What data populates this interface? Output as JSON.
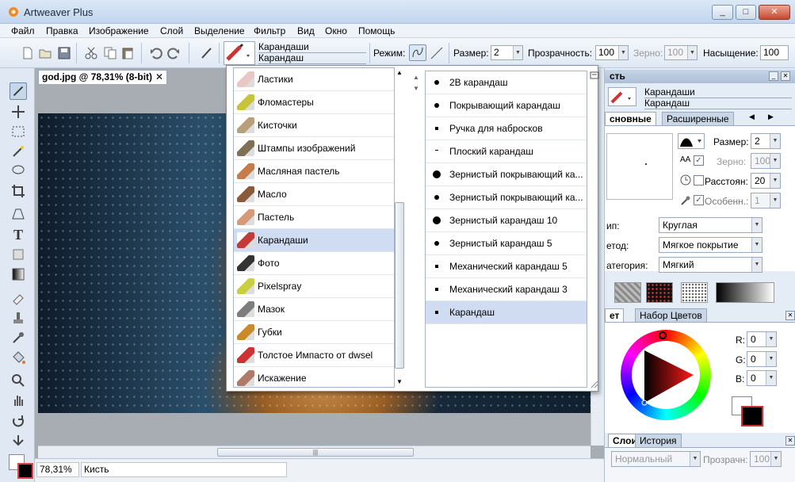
{
  "window": {
    "title": "Artweaver Plus",
    "min": "_",
    "max": "□",
    "close": "✕"
  },
  "menu": [
    "Файл",
    "Правка",
    "Изображение",
    "Слой",
    "Выделение",
    "Фильтр",
    "Вид",
    "Окно",
    "Помощь"
  ],
  "toolbar": {
    "brush_category": "Карандаши",
    "brush_variant": "Карандаш",
    "mode_label": "Режим:",
    "size_label": "Размер:",
    "size_value": "2",
    "opacity_label": "Прозрачность:",
    "opacity_value": "100",
    "grain_label": "Зерно:",
    "grain_value": "100",
    "saturation_label": "Насыщение:",
    "saturation_value": "100"
  },
  "document": {
    "tab_title": "god.jpg @ 78,31% (8-bit)",
    "close": "✕"
  },
  "status": {
    "zoom": "78,31%",
    "tool": "Кисть"
  },
  "popup": {
    "categories": [
      "Ластики",
      "Фломастеры",
      "Кисточки",
      "Штампы изображений",
      "Масляная пастель",
      "Масло",
      "Пастель",
      "Карандаши",
      "Фото",
      "Pixelspray",
      "Мазок",
      "Губки",
      "Толстое Импасто от dwsel",
      "Искажение"
    ],
    "selected_category": "Карандаши",
    "brushes": [
      "2B карандаш",
      "Покрывающий карандаш",
      "Ручка для набросков",
      "Плоский карандаш",
      "Зернистый покрывающий ка...",
      "Зернистый покрывающий ка...",
      "Зернистый карандаш 10",
      "Зернистый карандаш 5",
      "Механический карандаш 5",
      "Механический карандаш 3",
      "Карандаш"
    ],
    "selected_brush": "Карандаш"
  },
  "brush_panel": {
    "header": "сть",
    "category": "Карандаши",
    "variant": "Карандаш",
    "tab_basic": "сновные",
    "tab_advanced": "Расширенные",
    "size_label": "Размер:",
    "size_value": "2",
    "grain_label": "Зерно:",
    "grain_value": "100",
    "spacing_label": "Расстоян:",
    "spacing_value": "20",
    "feature_label": "Особенн.:",
    "feature_value": "1",
    "type_label": "ип:",
    "type_value": "Круглая",
    "method_label": "етод:",
    "method_value": "Мягкое покрытие",
    "category_label": "атегория:",
    "category_value": "Мягкий"
  },
  "color_panel": {
    "tab_color": "ет",
    "tab_set": "Набор Цветов",
    "r_label": "R:",
    "r_value": "0",
    "g_label": "G:",
    "g_value": "0",
    "b_label": "B:",
    "b_value": "0"
  },
  "layers_panel": {
    "tab_layers": "Слои",
    "tab_history": "История",
    "blend_mode": "Нормальный",
    "opacity_label": "Прозрачн:",
    "opacity_value": "100"
  },
  "colors": {
    "accent_selection": "#cfdcf1",
    "foreground": "#000000",
    "background": "#ffffff"
  }
}
